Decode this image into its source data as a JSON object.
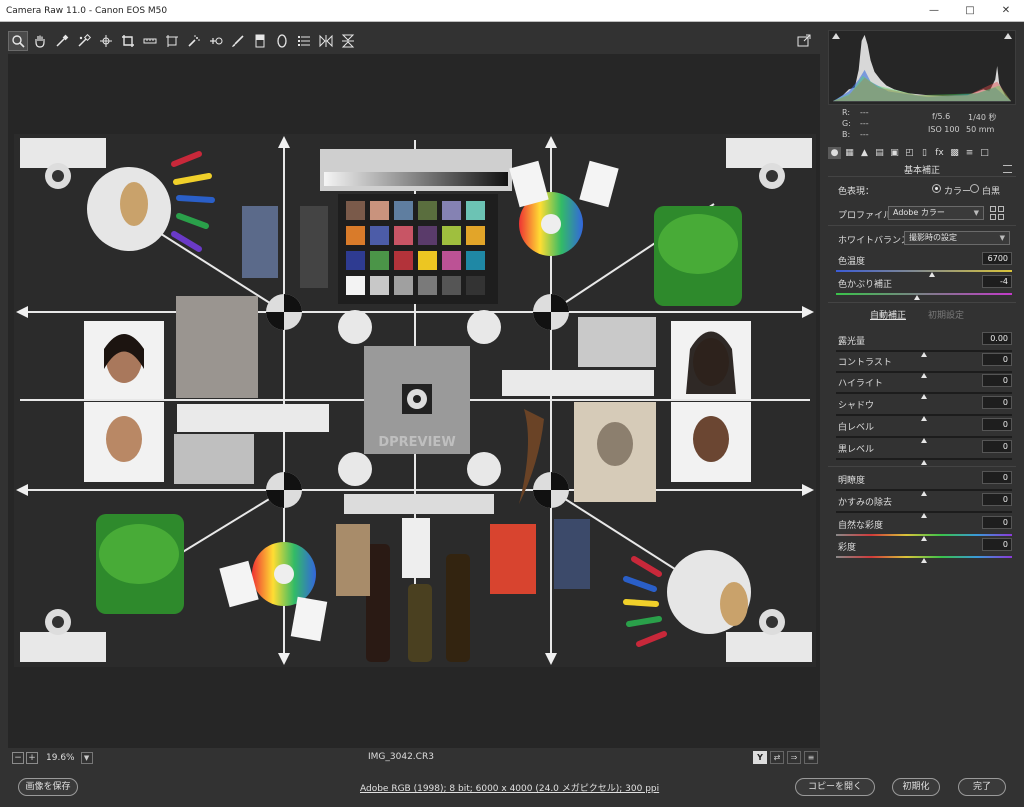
{
  "window": {
    "title": "Camera Raw 11.0  -  Canon EOS M50"
  },
  "toolbar": {
    "tools": [
      "zoom-icon",
      "hand-icon",
      "white-balance-icon",
      "color-sampler-icon",
      "targeted-adjustment-icon",
      "crop-icon",
      "straighten-icon",
      "transform-icon",
      "spot-removal-icon",
      "red-eye-icon",
      "adjustment-brush-icon",
      "graduated-filter-icon",
      "radial-filter-icon",
      "preferences-icon",
      "rotate-left-icon",
      "rotate-right-icon"
    ],
    "fullscreen_icon": "fullscreen-icon"
  },
  "preview": {
    "zoom": "19.6%",
    "filename": "IMG_3042.CR3",
    "view_mode": "Y"
  },
  "histogram": {
    "exposure": "f/5.6",
    "shutter": "1/40 秒",
    "iso": "ISO 100",
    "focal": "50 mm",
    "r_label": "R:",
    "g_label": "G:",
    "b_label": "B:",
    "r_val": "---",
    "g_val": "---",
    "b_val": "---"
  },
  "panel": {
    "title": "基本補正",
    "treatment_label": "色表現：",
    "treatment_color": "カラー",
    "treatment_bw": "白黒",
    "profile_label": "プロファイル：",
    "profile_value": "Adobe カラー",
    "wb_label": "ホワイトバランス：",
    "wb_value": "撮影時の設定",
    "temp_label": "色温度",
    "temp_value": "6700",
    "tint_label": "色かぶり補正",
    "tint_value": "-4",
    "auto_label": "自動補正",
    "default_label": "初期設定",
    "sliders": [
      {
        "label": "露光量",
        "value": "0.00"
      },
      {
        "label": "コントラスト",
        "value": "0"
      },
      {
        "label": "ハイライト",
        "value": "0"
      },
      {
        "label": "シャドウ",
        "value": "0"
      },
      {
        "label": "白レベル",
        "value": "0"
      },
      {
        "label": "黒レベル",
        "value": "0"
      },
      {
        "label": "明瞭度",
        "value": "0"
      },
      {
        "label": "かすみの除去",
        "value": "0"
      },
      {
        "label": "自然な彩度",
        "value": "0"
      },
      {
        "label": "彩度",
        "value": "0"
      }
    ]
  },
  "photo": {
    "watermark": "DPREVIEW"
  },
  "bottom": {
    "save_label": "画像を保存",
    "workflow_link": "Adobe RGB (1998); 8 bit; 6000 x 4000 (24.0 メガピクセル); 300 ppi",
    "open_copy_label": "コピーを開く",
    "reset_label": "初期化",
    "done_label": "完了"
  },
  "colors": {
    "accent": "#e6e6e6",
    "panel": "#323232",
    "preview_bg": "#262626"
  }
}
